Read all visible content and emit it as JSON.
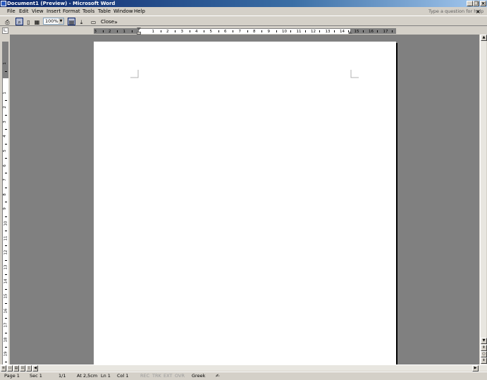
{
  "window": {
    "title": "Document1 (Preview) - Microsoft Word"
  },
  "menu": {
    "items": [
      "File",
      "Edit",
      "View",
      "Insert",
      "Format",
      "Tools",
      "Table",
      "Window",
      "Help"
    ],
    "help_placeholder": "Type a question for help"
  },
  "toolbar": {
    "zoom": "100%",
    "close_label": "Close"
  },
  "ruler": {
    "horizontal_labels": [
      "3",
      "2",
      "1",
      "1",
      "2",
      "3",
      "4",
      "5",
      "6",
      "7",
      "8",
      "9",
      "10",
      "11",
      "12",
      "13",
      "14",
      "15",
      "16",
      "17"
    ],
    "vertical_labels": [
      "1",
      "1",
      "2",
      "3",
      "4",
      "5",
      "6",
      "7",
      "8",
      "9",
      "10",
      "11",
      "12",
      "13",
      "14",
      "15",
      "16",
      "17",
      "18",
      "19"
    ]
  },
  "status": {
    "page": "Page 1",
    "sec": "Sec 1",
    "pages": "1/1",
    "at": "At 2,5cm",
    "ln": "Ln 1",
    "col": "Col 1",
    "rec": "REC",
    "trk": "TRK",
    "ext": "EXT",
    "ovr": "OVR",
    "language": "Greek"
  }
}
